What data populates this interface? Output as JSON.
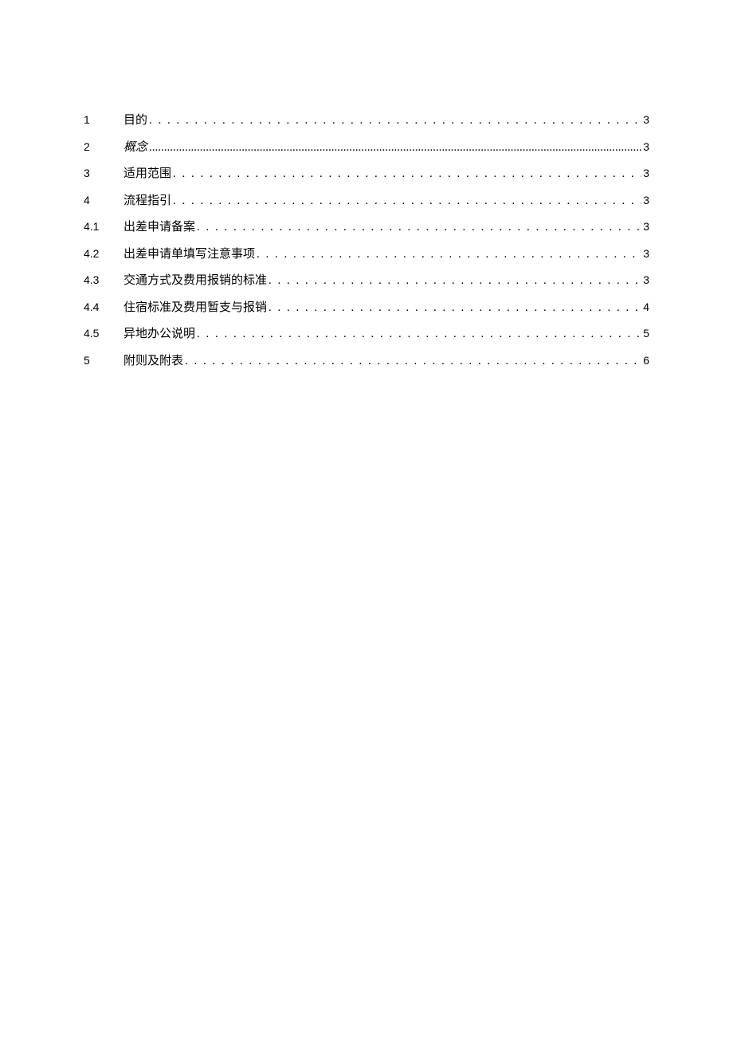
{
  "toc": {
    "entries": [
      {
        "number": "1",
        "title": "目的",
        "page": "3",
        "italic": false,
        "fine": false
      },
      {
        "number": "2",
        "title": "概念",
        "page": "3",
        "italic": true,
        "fine": true
      },
      {
        "number": "3",
        "title": "适用范围",
        "page": "3",
        "italic": false,
        "fine": false
      },
      {
        "number": "4",
        "title": "流程指引",
        "page": "3",
        "italic": false,
        "fine": false
      },
      {
        "number": "4.1",
        "title": "出差申请备案",
        "page": "3",
        "italic": false,
        "fine": false
      },
      {
        "number": "4.2",
        "title": "出差申请单填写注意事项",
        "page": "3",
        "italic": false,
        "fine": false
      },
      {
        "number": "4.3",
        "title": "交通方式及费用报销的标准",
        "page": "3",
        "italic": false,
        "fine": false
      },
      {
        "number": "4.4",
        "title": "住宿标准及费用暂支与报销",
        "page": "4",
        "italic": false,
        "fine": false
      },
      {
        "number": "4.5",
        "title": "异地办公说明",
        "page": "5",
        "italic": false,
        "fine": false
      },
      {
        "number": "5",
        "title": "附则及附表",
        "page": "6",
        "italic": false,
        "fine": false
      }
    ]
  }
}
